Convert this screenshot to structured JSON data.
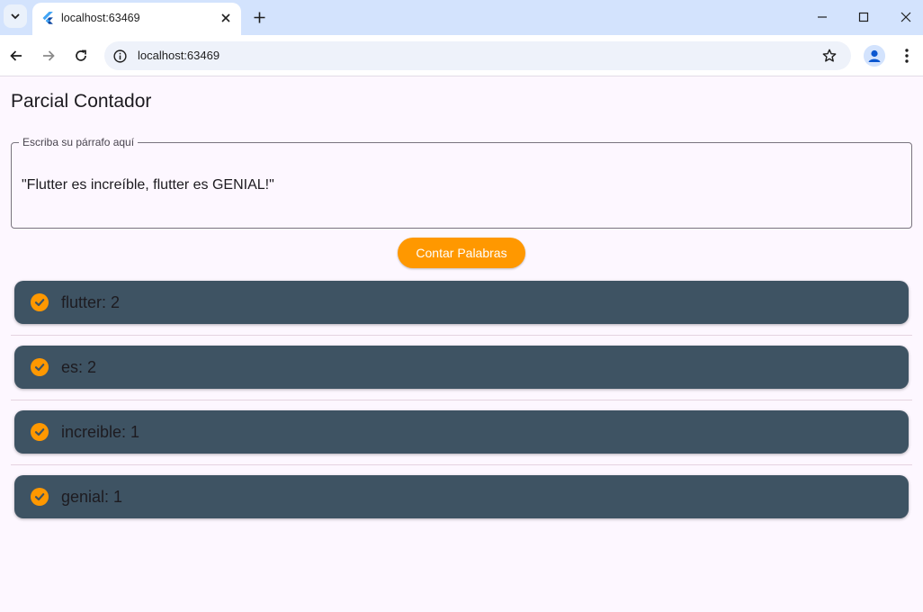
{
  "browser": {
    "tab_title": "localhost:63469",
    "url": "localhost:63469",
    "icons": [
      "tab-search-icon",
      "flutter-icon",
      "close-icon",
      "plus-icon",
      "minimize-icon",
      "maximize-icon",
      "window-close-icon",
      "back-icon",
      "forward-icon",
      "reload-icon",
      "info-icon",
      "star-icon",
      "profile-icon",
      "kebab-menu-icon"
    ]
  },
  "app": {
    "title": "Parcial Contador",
    "input": {
      "label": "Escriba su párrafo aquí",
      "value": "\"Flutter es increíble, flutter es GENIAL!\""
    },
    "button_label": "Contar Palabras",
    "results": [
      {
        "label": "flutter: 2"
      },
      {
        "label": "es: 2"
      },
      {
        "label": "increible: 1"
      },
      {
        "label": "genial: 1"
      }
    ]
  },
  "colors": {
    "accent": "#ff9800",
    "card": "#3e5363",
    "background": "#fdf7ff"
  }
}
